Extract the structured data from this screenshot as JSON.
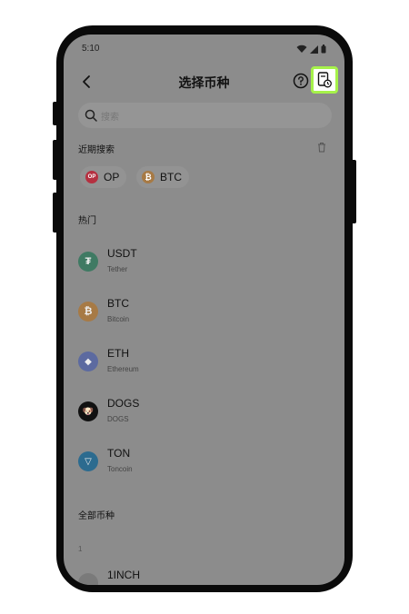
{
  "status_bar": {
    "time": "5:10"
  },
  "header": {
    "title": "选择币种"
  },
  "search": {
    "placeholder": "搜索"
  },
  "recent": {
    "label": "近期搜索",
    "chips": [
      {
        "symbol": "OP",
        "logo_text": "OP",
        "color": "#b53040"
      },
      {
        "symbol": "BTC",
        "logo_text": "₿",
        "color": "#a77a45"
      }
    ]
  },
  "hot": {
    "label": "热门",
    "coins": [
      {
        "symbol": "USDT",
        "name": "Tether",
        "logo_text": "₮",
        "color": "#3f7a63"
      },
      {
        "symbol": "BTC",
        "name": "Bitcoin",
        "logo_text": "₿",
        "color": "#a77a45"
      },
      {
        "symbol": "ETH",
        "name": "Ethereum",
        "logo_text": "◆",
        "color": "#5c6aa0"
      },
      {
        "symbol": "DOGS",
        "name": "DOGS",
        "logo_text": "🐶",
        "color": "#111111"
      },
      {
        "symbol": "TON",
        "name": "Toncoin",
        "logo_text": "▽",
        "color": "#2c6b8f"
      }
    ]
  },
  "all": {
    "label": "全部币种",
    "index_letter": "1",
    "coins": [
      {
        "symbol": "1INCH",
        "logo_text": "",
        "color": "#7a7a7a"
      }
    ]
  },
  "colors": {
    "highlight": "#a6f24a",
    "overlay": "#8c8c8c"
  }
}
